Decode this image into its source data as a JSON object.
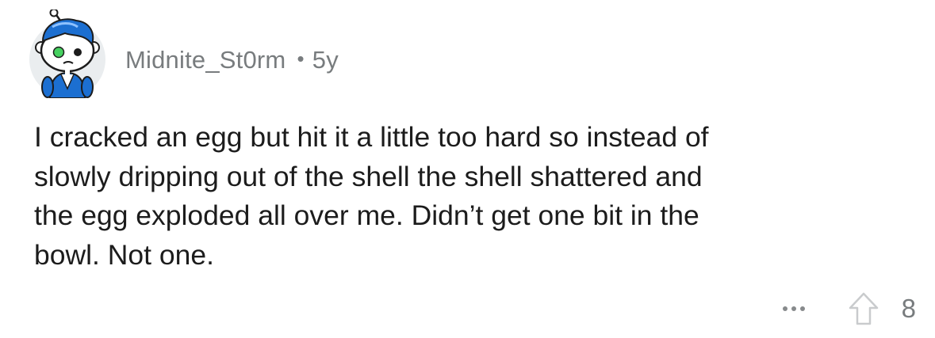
{
  "comment": {
    "author": "Midnite_St0rm",
    "separator": "•",
    "age": "5y",
    "body": "I cracked an egg but hit it a little too hard so instead of\nslowly dripping out of the shell the shell shattered and\nthe egg exploded all over me. Didn’t get one bit in the\nbowl. Not one.",
    "score": "8"
  },
  "icons": {
    "avatar": "snoo-avatar-icon",
    "more": "more-options-icon",
    "upvote": "upvote-arrow-icon"
  },
  "colors": {
    "background": "#ffffff",
    "meta_text": "#787c7e",
    "body_text": "#1c1c1c",
    "avatar_bg": "#eaedef",
    "hair": "#1c6fd1",
    "jacket": "#1c6fd1",
    "eye": "#46d160"
  }
}
